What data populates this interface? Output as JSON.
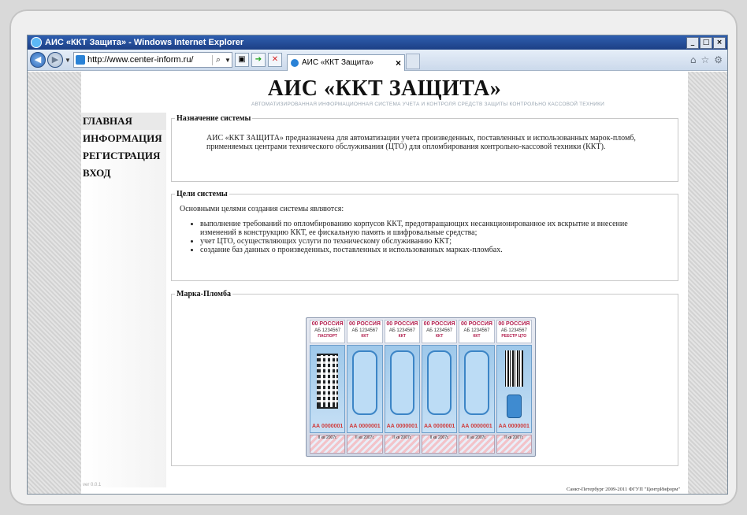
{
  "browser": {
    "window_title": "АИС «ККТ Защита» - Windows Internet Explorer",
    "url": "http://www.center-inform.ru/",
    "tab_label": "АИС «ККТ Защита»"
  },
  "site": {
    "title": "АИС «ККТ ЗАЩИТА»",
    "subtitle": "АВТОМАТИЗИРОВАННАЯ ИНФОРМАЦИОННАЯ СИСТЕМА УЧЕТА И КОНТРОЛЯ СРЕДСТВ ЗАЩИТЫ КОНТРОЛЬНО КАССОВОЙ ТЕХНИКИ",
    "version": "ver 0.0.1",
    "copyright": "Санкт-Петербург 2009-2011 ФГУП \"ЦентрИнформ\""
  },
  "menu": {
    "items": [
      {
        "label": "ГЛАВНАЯ"
      },
      {
        "label": "ИНФОРМАЦИЯ"
      },
      {
        "label": "РЕГИСТРАЦИЯ"
      },
      {
        "label": "ВХОД"
      }
    ]
  },
  "sections": {
    "purpose": {
      "title": "Назначение системы",
      "text": "АИС «ККТ ЗАЩИТА» предназначена для автоматизации учета произведенных, поставленных и использованных марок-пломб, применяемых центрами технического обслуживания (ЦТО) для опломбирования контрольно-кассовой техники (ККТ)."
    },
    "goals": {
      "title": "Цели системы",
      "intro": "Основными целями создания системы являются:",
      "items": [
        "выполнение требований по опломбированию корпусов ККТ, предотвращающих несанкционированное их вскрытие и внесение изменений в конструкцию ККТ, ее фискальную память и шифровальные средства;",
        "учет ЦТО, осуществляющих услуги по техническому обслуживанию ККТ;",
        "создание баз данных о произведенных, поставленных и использованных марках-пломбах."
      ]
    },
    "stamp": {
      "title": "Марка-Пломба",
      "strips": [
        {
          "country": "00 РОССИЯ",
          "number": "АБ 1234567",
          "label": "ПАСПОРТ"
        },
        {
          "country": "00 РОССИЯ",
          "number": "АБ 1234567",
          "label": "ККТ"
        },
        {
          "country": "00 РОССИЯ",
          "number": "АБ 1234567",
          "label": "ККТ"
        },
        {
          "country": "00 РОССИЯ",
          "number": "АБ 1234567",
          "label": "ККТ"
        },
        {
          "country": "00 РОССИЯ",
          "number": "АБ 1234567",
          "label": "ККТ"
        },
        {
          "country": "00 РОССИЯ",
          "number": "АБ 1234567",
          "label": "РЕЕСТР ЦТО"
        }
      ],
      "serial": "АА 0000001",
      "quarter": "II кв 2007г."
    }
  }
}
